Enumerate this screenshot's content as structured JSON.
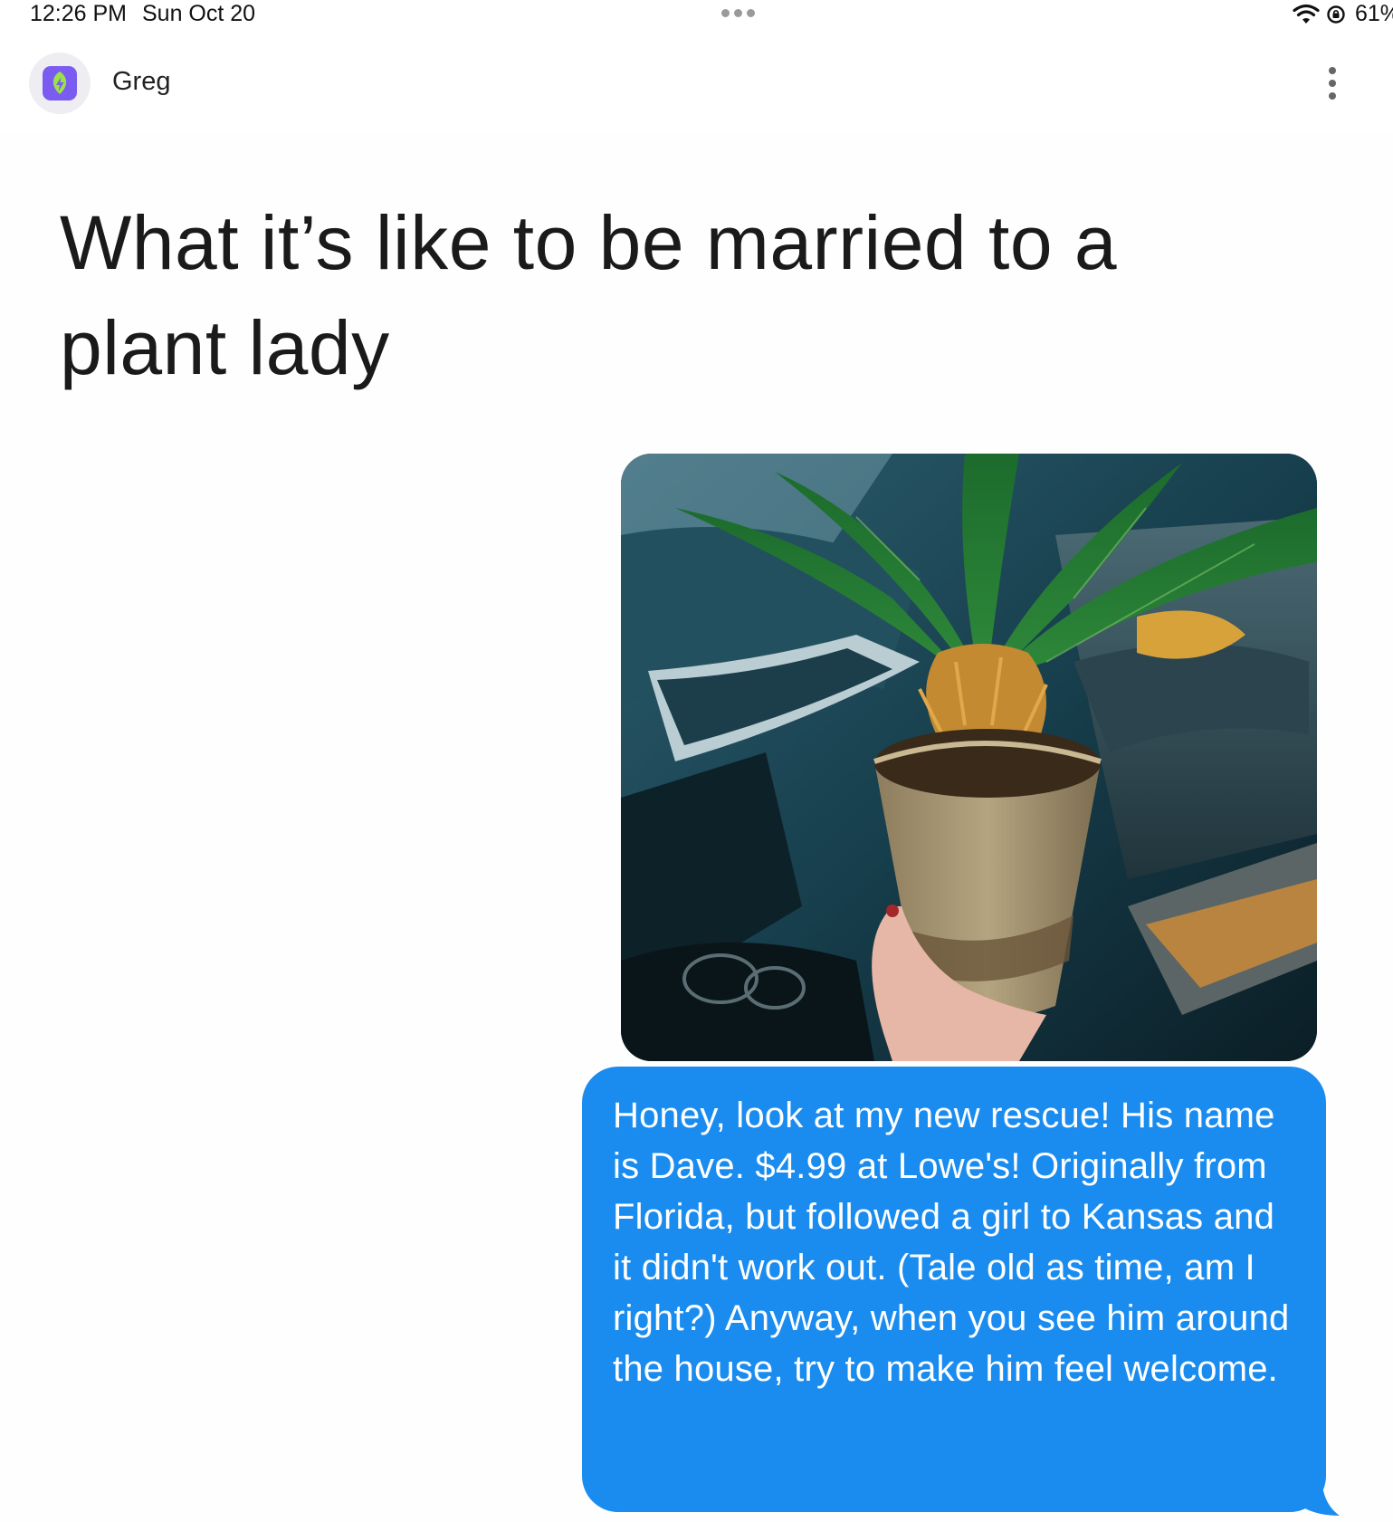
{
  "status_bar": {
    "time": "12:26 PM",
    "date": "Sun Oct 20",
    "battery": "61%"
  },
  "header": {
    "contact_name": "Greg",
    "avatar_icon": "leaf-bolt-icon"
  },
  "post": {
    "title": "What it’s like to be married to a plant lady",
    "photo_description_icon": "potted-sago-palm-photo",
    "message_text": "Honey, look at my new rescue! His name is Dave. $4.99 at Lowe's! Originally from Florida, but followed a girl to Kansas and it didn't work out. (Tale old as time, am I right?) Anyway, when you see him around the house, try to make him feel welcome."
  },
  "colors": {
    "bubble_blue": "#1a8cf0",
    "avatar_purple": "#7b5cf0",
    "leaf_green": "#9be24a"
  }
}
